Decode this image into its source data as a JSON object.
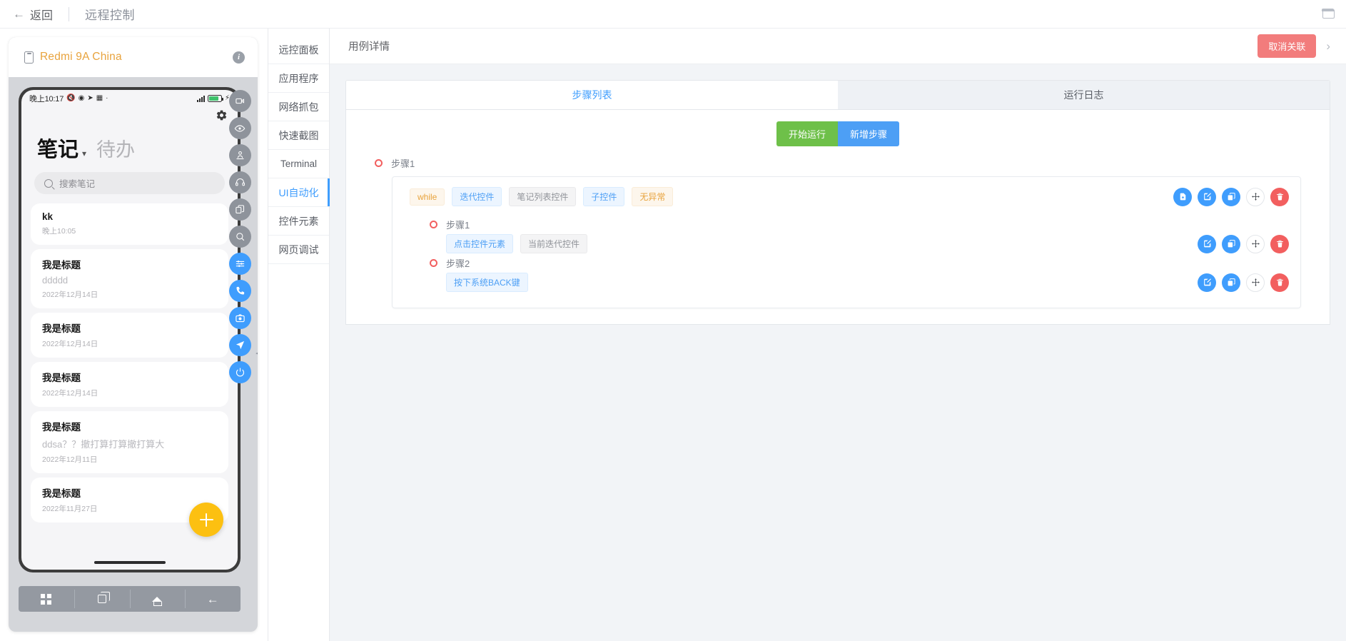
{
  "topbar": {
    "back_label": "返回",
    "back_icon": "arrow-left-icon",
    "title": "远程控制",
    "window_icon": "window-restore-icon"
  },
  "device": {
    "phone_icon": "phone-outline-icon",
    "name": "Redmi 9A China",
    "name_color": "#e8a33d",
    "info_icon": "info-icon",
    "status_bar": {
      "time": "晚上10:17",
      "icons": [
        "mute-icon",
        "globe-icon",
        "location-icon",
        "sim-icon",
        "dot-icon"
      ],
      "signal_icon": "signal-bars-icon",
      "battery_icon": "battery-icon",
      "battery_level": "82%",
      "battery_color": "#3ec16b",
      "bolt_icon": "bolt-icon"
    },
    "app": {
      "gear_icon": "gear-icon",
      "tab_active": "笔记",
      "tab_caret": "chevron-down-icon",
      "tab_inactive": "待办",
      "search_icon": "search-icon",
      "search_placeholder": "搜索笔记",
      "fab_icon": "plus-icon",
      "fab_color": "#fcc011",
      "notes": [
        {
          "title": "kk",
          "subtitle": "",
          "date": "晚上10:05"
        },
        {
          "title": "我是标题",
          "subtitle": "ddddd",
          "date": "2022年12月14日"
        },
        {
          "title": "我是标题",
          "subtitle": "",
          "date": "2022年12月14日"
        },
        {
          "title": "我是标题",
          "subtitle": "",
          "date": "2022年12月14日"
        },
        {
          "title": "我是标题",
          "subtitle": "ddsa？？撤打算打算撤打算大",
          "date": "2022年12月11日"
        },
        {
          "title": "我是标题",
          "subtitle": "",
          "date": "2022年11月27日"
        }
      ]
    },
    "nav_bar": [
      {
        "icon": "apps-grid-icon",
        "label": "菜单"
      },
      {
        "icon": "recents-icon",
        "label": "最近任务"
      },
      {
        "icon": "home-icon",
        "label": "主屏幕"
      },
      {
        "icon": "back-icon",
        "label": "返回"
      }
    ],
    "toolbar": [
      {
        "icon": "video-record-icon",
        "style": "gray"
      },
      {
        "icon": "eye-icon",
        "style": "gray"
      },
      {
        "icon": "user-location-icon",
        "style": "gray"
      },
      {
        "icon": "headset-icon",
        "style": "gray"
      },
      {
        "icon": "copy-icon",
        "style": "gray"
      },
      {
        "icon": "search-icon",
        "style": "gray"
      },
      {
        "icon": "sliders-icon",
        "style": "blue"
      },
      {
        "icon": "phone-call-icon",
        "style": "blue"
      },
      {
        "icon": "camera-icon",
        "style": "blue"
      },
      {
        "icon": "navigate-icon",
        "style": "blue"
      },
      {
        "icon": "power-icon",
        "style": "blue"
      }
    ],
    "collapse_icon": "chevron-left-icon"
  },
  "sidebar": {
    "items": [
      {
        "label": "远控面板",
        "active": false
      },
      {
        "label": "应用程序",
        "active": false
      },
      {
        "label": "网络抓包",
        "active": false
      },
      {
        "label": "快速截图",
        "active": false
      },
      {
        "label": "Terminal",
        "active": false
      },
      {
        "label": "UI自动化",
        "active": true
      },
      {
        "label": "控件元素",
        "active": false
      },
      {
        "label": "网页调试",
        "active": false
      }
    ],
    "accent": "#3f9dfd"
  },
  "panel": {
    "title": "用例详情",
    "unlink_label": "取消关联",
    "unlink_color": "#f27c7c",
    "chevron_icon": "chevron-right-icon",
    "tabs": [
      {
        "label": "步骤列表",
        "active": true
      },
      {
        "label": "运行日志",
        "active": false
      }
    ],
    "run_label": "开始运行",
    "run_color": "#6ec049",
    "add_label": "新增步骤",
    "add_color": "#4d9ff5"
  },
  "steps": {
    "root": {
      "marker_icon": "circle-outline-icon",
      "label": "步骤1",
      "tags": [
        {
          "text": "while",
          "style": "orange"
        },
        {
          "text": "迭代控件",
          "style": "blue"
        },
        {
          "text": "笔记列表控件",
          "style": "gray"
        },
        {
          "text": "子控件",
          "style": "blue"
        },
        {
          "text": "无异常",
          "style": "orange"
        }
      ],
      "actions": [
        {
          "icon": "file-add-icon",
          "style": "blue"
        },
        {
          "icon": "edit-icon",
          "style": "blue"
        },
        {
          "icon": "copy-icon",
          "style": "blue"
        },
        {
          "icon": "move-icon",
          "style": "plain"
        },
        {
          "icon": "trash-icon",
          "style": "red"
        }
      ]
    },
    "children": [
      {
        "marker_icon": "circle-outline-icon",
        "label": "步骤1",
        "tags": [
          {
            "text": "点击控件元素",
            "style": "blue"
          },
          {
            "text": "当前迭代控件",
            "style": "gray"
          }
        ],
        "actions": [
          {
            "icon": "edit-icon",
            "style": "blue"
          },
          {
            "icon": "copy-icon",
            "style": "blue"
          },
          {
            "icon": "move-icon",
            "style": "plain"
          },
          {
            "icon": "trash-icon",
            "style": "red"
          }
        ]
      },
      {
        "marker_icon": "circle-outline-icon",
        "label": "步骤2",
        "tags": [
          {
            "text": "按下系统BACK键",
            "style": "blue"
          }
        ],
        "actions": [
          {
            "icon": "edit-icon",
            "style": "blue"
          },
          {
            "icon": "copy-icon",
            "style": "blue"
          },
          {
            "icon": "move-icon",
            "style": "plain"
          },
          {
            "icon": "trash-icon",
            "style": "red"
          }
        ]
      }
    ]
  }
}
